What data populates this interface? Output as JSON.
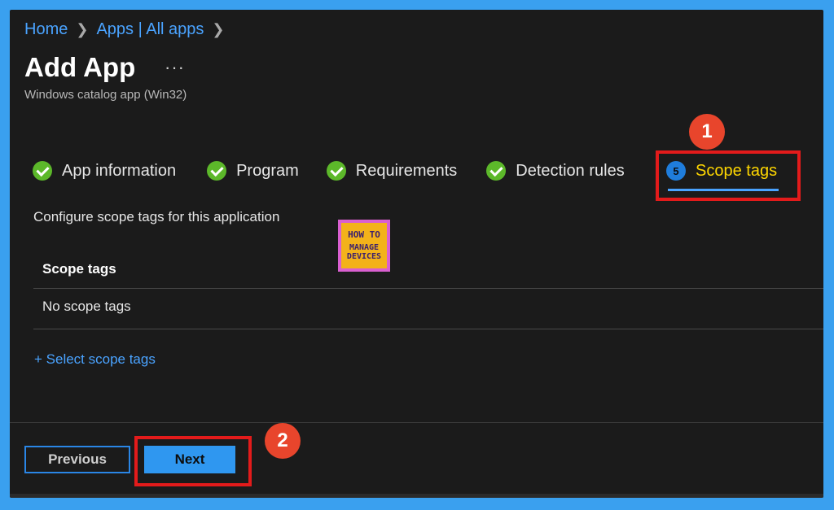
{
  "breadcrumb": {
    "home": "Home",
    "apps": "Apps | All apps"
  },
  "header": {
    "title": "Add App",
    "more": "···",
    "subtitle": "Windows catalog app (Win32)"
  },
  "wizard": {
    "steps": [
      {
        "label": "App information",
        "status": "complete"
      },
      {
        "label": "Program",
        "status": "complete"
      },
      {
        "label": "Requirements",
        "status": "complete"
      },
      {
        "label": "Detection rules",
        "status": "complete"
      },
      {
        "label": "Scope tags",
        "status": "active",
        "number": "5"
      }
    ]
  },
  "annotations": {
    "badge1": "1",
    "badge2": "2"
  },
  "content": {
    "intro": "Configure scope tags for this application",
    "table_header": "Scope tags",
    "empty_text": "No scope tags",
    "select_link": "+ Select scope tags"
  },
  "watermark": {
    "line1": "HOW TO",
    "line2": "MANAGE",
    "line3": "DEVICES"
  },
  "footer": {
    "previous_label": "Previous",
    "next_label": "Next"
  },
  "colors": {
    "accent": "#2f97f0",
    "link": "#4aa3ff",
    "active_step": "#ffd700",
    "check": "#5cb82a",
    "annotation": "#e31b1b",
    "badge": "#e8452c"
  }
}
